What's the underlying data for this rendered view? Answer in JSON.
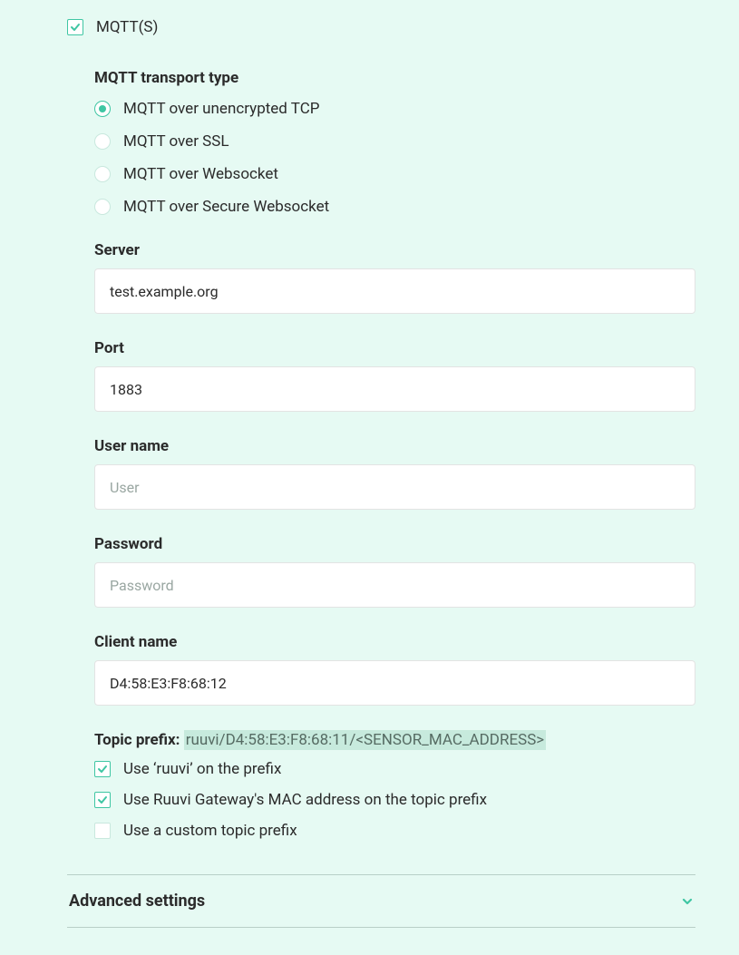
{
  "mqtt": {
    "enable_label": "MQTT(S)",
    "enable_checked": true,
    "transport": {
      "heading": "MQTT transport type",
      "options": [
        {
          "label": "MQTT over unencrypted TCP",
          "selected": true
        },
        {
          "label": "MQTT over SSL",
          "selected": false
        },
        {
          "label": "MQTT over Websocket",
          "selected": false
        },
        {
          "label": "MQTT over Secure Websocket",
          "selected": false
        }
      ]
    },
    "server": {
      "label": "Server",
      "value": "test.example.org"
    },
    "port": {
      "label": "Port",
      "value": "1883"
    },
    "username": {
      "label": "User name",
      "value": "",
      "placeholder": "User"
    },
    "password": {
      "label": "Password",
      "value": "",
      "placeholder": "Password"
    },
    "client_name": {
      "label": "Client name",
      "value": "D4:58:E3:F8:68:12"
    },
    "topic_prefix": {
      "label": "Topic prefix:",
      "value": "ruuvi/D4:58:E3:F8:68:11/<SENSOR_MAC_ADDRESS>",
      "options": [
        {
          "label": "Use ‘ruuvi’ on the prefix",
          "checked": true
        },
        {
          "label": "Use Ruuvi Gateway's MAC address on the topic prefix",
          "checked": true
        },
        {
          "label": "Use a custom topic prefix",
          "checked": false
        }
      ]
    }
  },
  "advanced": {
    "title": "Advanced settings",
    "expanded": false
  },
  "colors": {
    "accent": "#3fc6a3",
    "bg": "#e6faf3"
  }
}
